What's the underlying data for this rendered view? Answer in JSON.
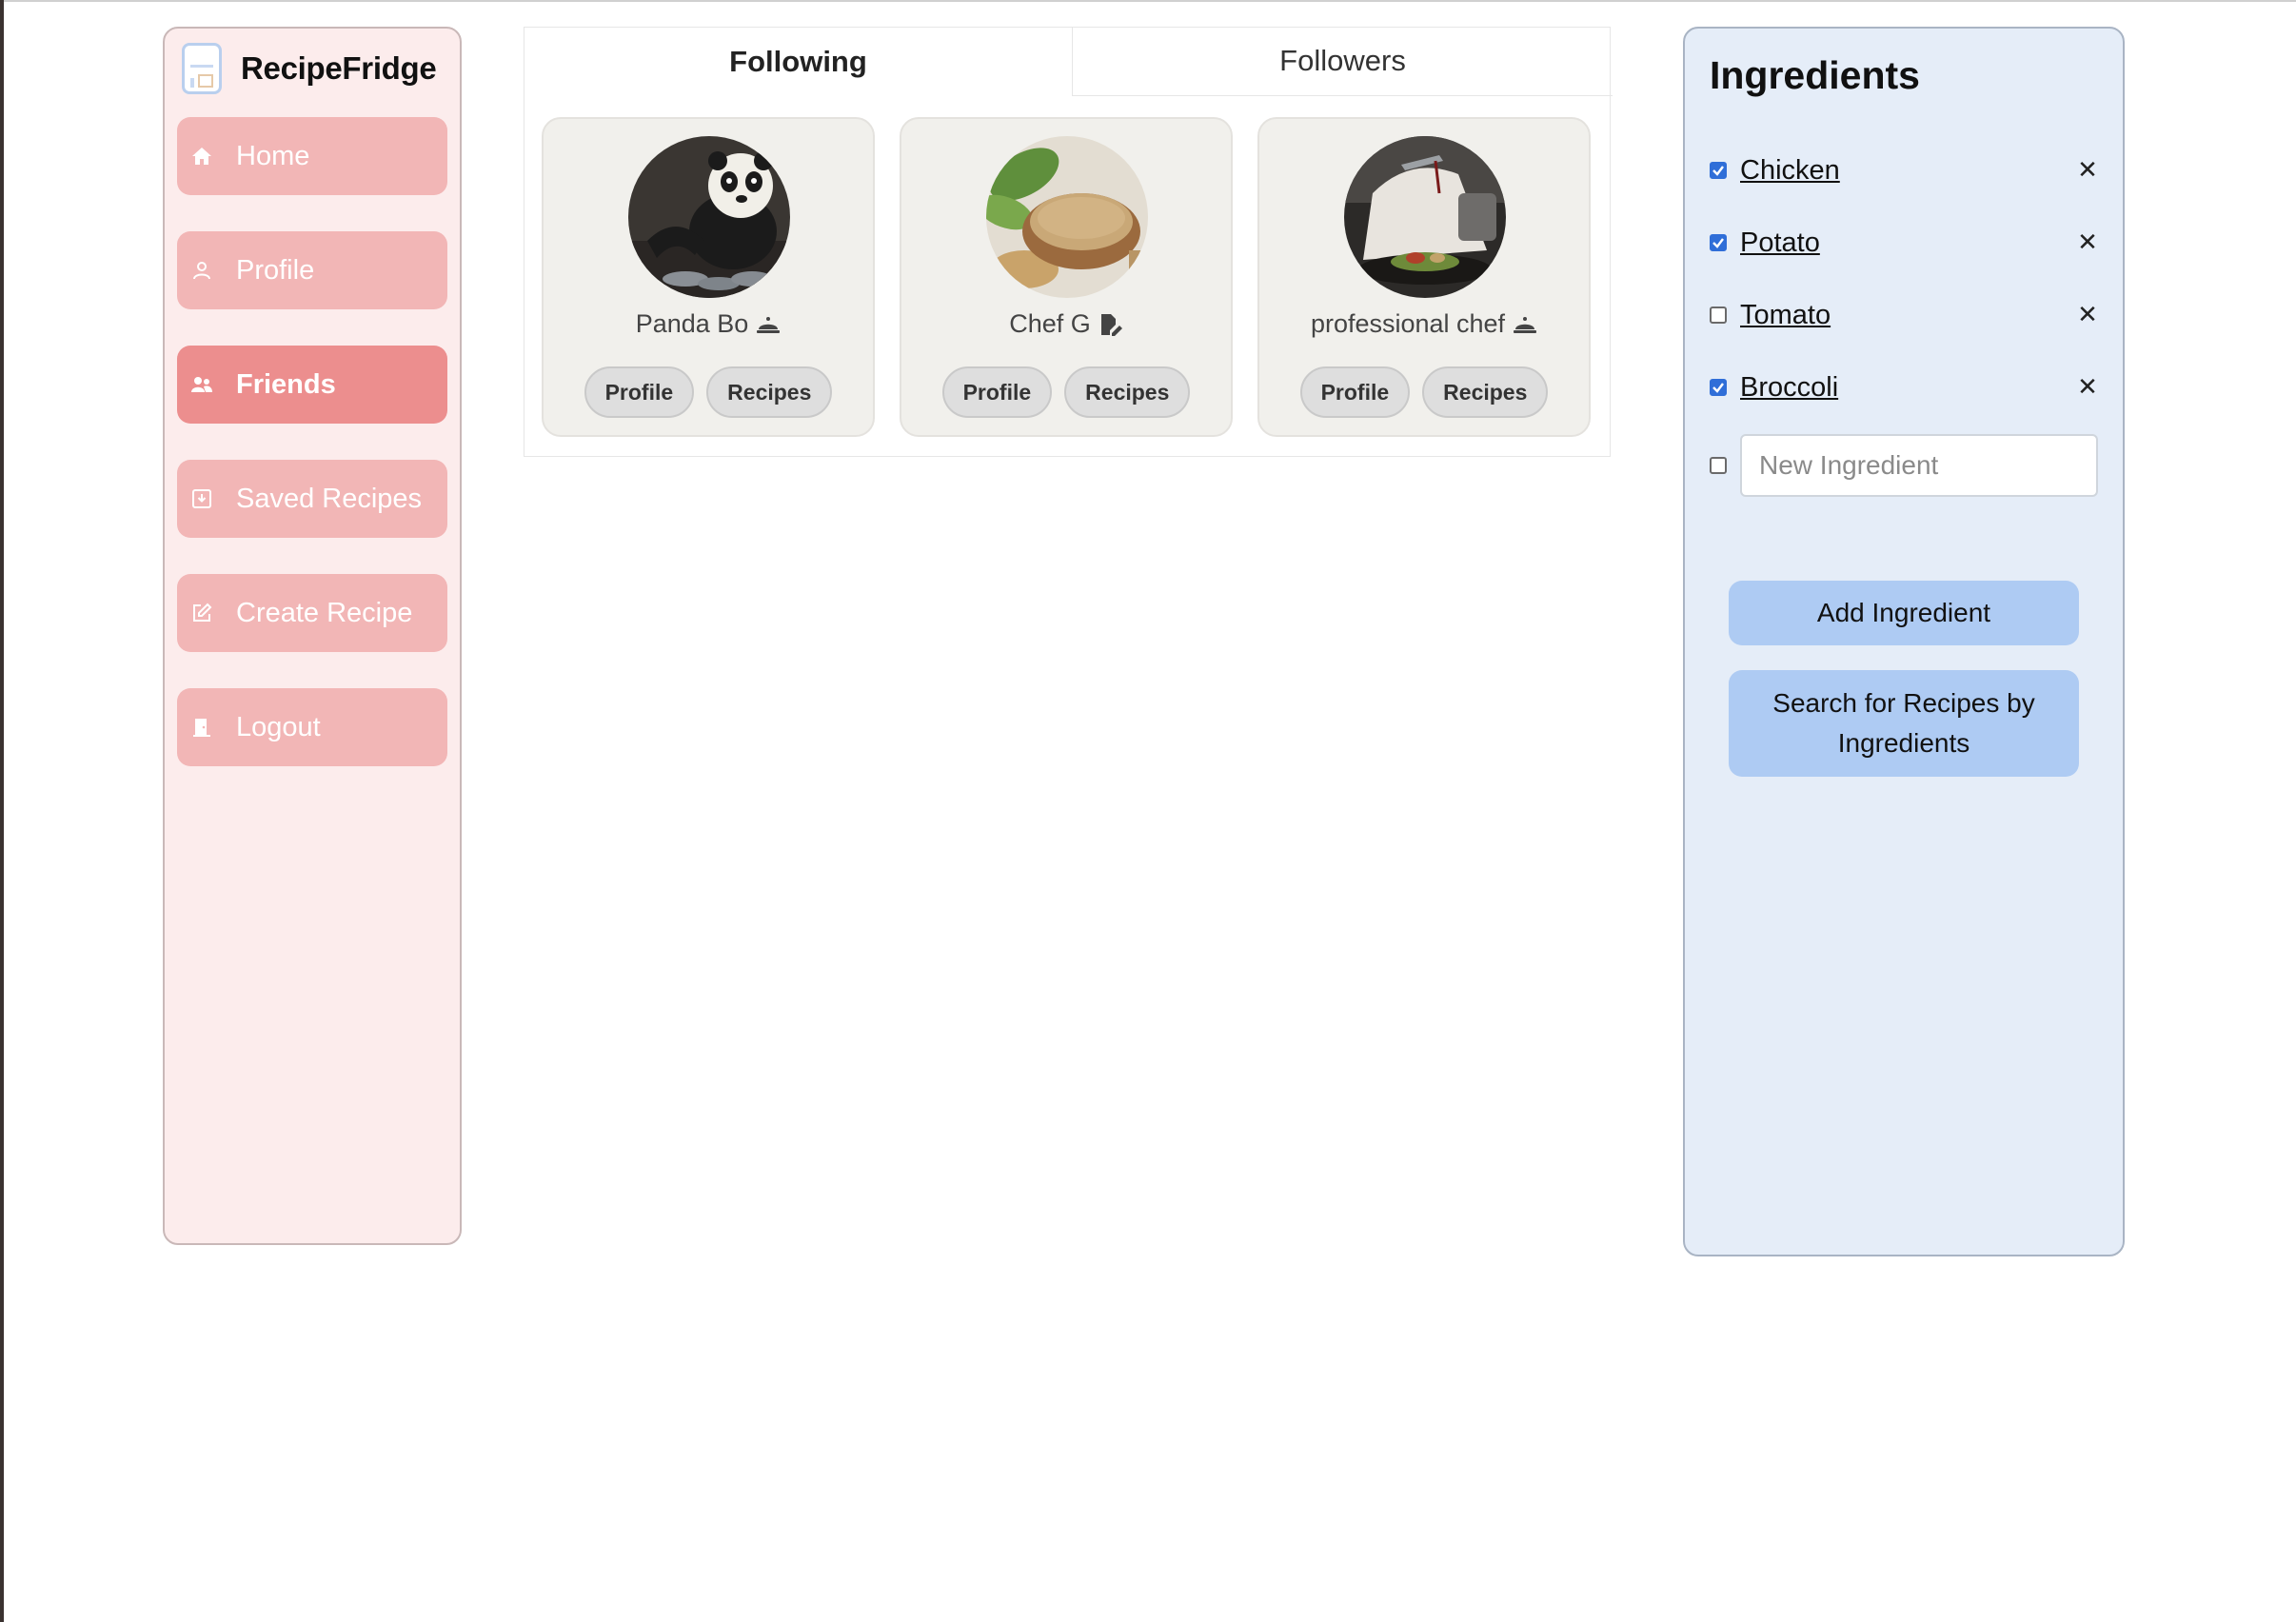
{
  "app": {
    "name": "RecipeFridge"
  },
  "sidebar": {
    "items": [
      {
        "label": "Home",
        "icon": "home-icon"
      },
      {
        "label": "Profile",
        "icon": "user-icon"
      },
      {
        "label": "Friends",
        "icon": "users-icon",
        "active": true
      },
      {
        "label": "Saved Recipes",
        "icon": "save-icon"
      },
      {
        "label": "Create Recipe",
        "icon": "edit-icon"
      },
      {
        "label": "Logout",
        "icon": "door-icon"
      }
    ]
  },
  "tabs": [
    {
      "label": "Following",
      "active": true
    },
    {
      "label": "Followers",
      "active": false
    }
  ],
  "cards": [
    {
      "name": "Panda Bo",
      "badge_icon": "cloche-icon",
      "profile_label": "Profile",
      "recipes_label": "Recipes"
    },
    {
      "name": "Chef G",
      "badge_icon": "file-pen-icon",
      "profile_label": "Profile",
      "recipes_label": "Recipes"
    },
    {
      "name": "professional chef",
      "badge_icon": "cloche-icon",
      "profile_label": "Profile",
      "recipes_label": "Recipes"
    }
  ],
  "ingredients": {
    "title": "Ingredients",
    "items": [
      {
        "label": "Chicken",
        "checked": true
      },
      {
        "label": "Potato",
        "checked": true
      },
      {
        "label": "Tomato",
        "checked": false
      },
      {
        "label": "Broccoli",
        "checked": true
      }
    ],
    "remove_symbol": "✕",
    "new_placeholder": "New Ingredient",
    "add_button": "Add Ingredient",
    "search_button": "Search for Recipes by Ingredients"
  },
  "colors": {
    "sidebar_bg": "#fcecec",
    "nav_item": "#f2b6b6",
    "nav_active": "#ec8e8e",
    "panel_bg": "#e5edf8",
    "blue_button": "#aecbf3",
    "card_bg": "#f1f0ec"
  }
}
